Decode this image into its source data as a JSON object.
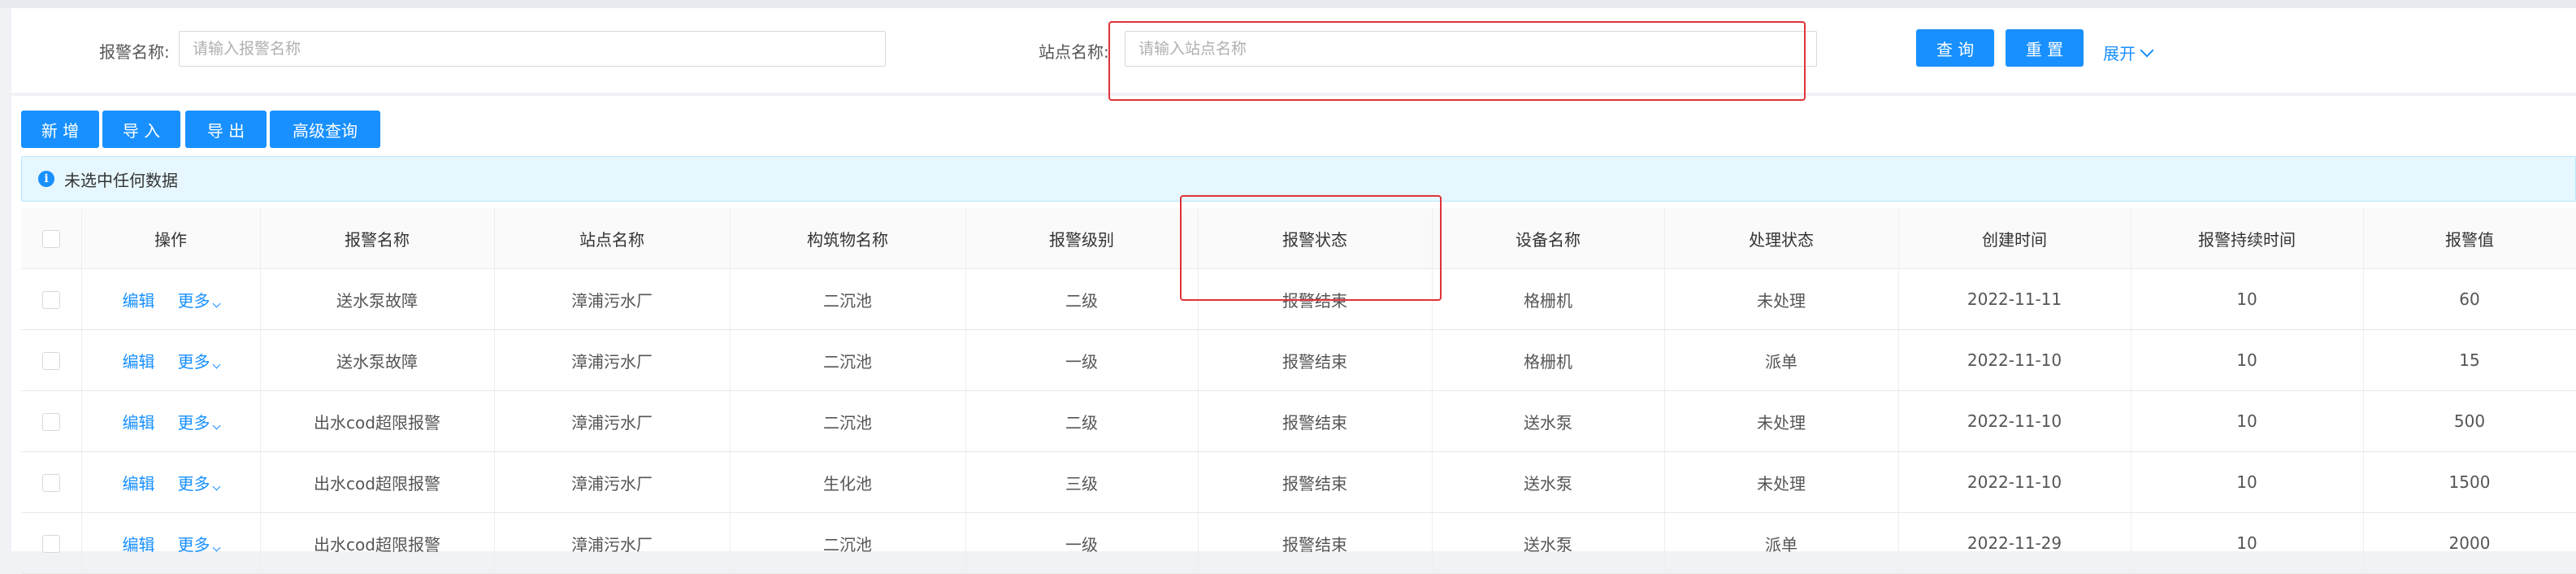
{
  "search": {
    "alarm_name_label": "报警名称:",
    "alarm_name_placeholder": "请输入报警名称",
    "site_name_label": "站点名称:",
    "site_name_placeholder": "请输入站点名称",
    "query_button": "查 询",
    "reset_button": "重 置",
    "expand_link": "展开"
  },
  "toolbar": {
    "add_button": "新 增",
    "import_button": "导 入",
    "export_button": "导 出",
    "advanced_query_button": "高级查询"
  },
  "selection_info": "未选中任何数据",
  "table": {
    "columns": [
      "操作",
      "报警名称",
      "站点名称",
      "构筑物名称",
      "报警级别",
      "报警状态",
      "设备名称",
      "处理状态",
      "创建时间",
      "报警持续时间",
      "报警值"
    ],
    "edit_label": "编辑",
    "more_label": "更多",
    "rows": [
      [
        "送水泵故障",
        "漳浦污水厂",
        "二沉池",
        "二级",
        "报警结束",
        "格栅机",
        "未处理",
        "2022-11-11",
        "10",
        "60"
      ],
      [
        "送水泵故障",
        "漳浦污水厂",
        "二沉池",
        "一级",
        "报警结束",
        "格栅机",
        "派单",
        "2022-11-10",
        "10",
        "15"
      ],
      [
        "出水cod超限报警",
        "漳浦污水厂",
        "二沉池",
        "二级",
        "报警结束",
        "送水泵",
        "未处理",
        "2022-11-10",
        "10",
        "500"
      ],
      [
        "出水cod超限报警",
        "漳浦污水厂",
        "生化池",
        "三级",
        "报警结束",
        "送水泵",
        "未处理",
        "2022-11-10",
        "10",
        "1500"
      ],
      [
        "出水cod超限报警",
        "漳浦污水厂",
        "二沉池",
        "一级",
        "报警结束",
        "送水泵",
        "派单",
        "2022-11-29",
        "10",
        "2000"
      ]
    ]
  },
  "colors": {
    "primary": "#1890ff",
    "highlight": "#e0323a",
    "info_bg": "#e6f7ff"
  }
}
